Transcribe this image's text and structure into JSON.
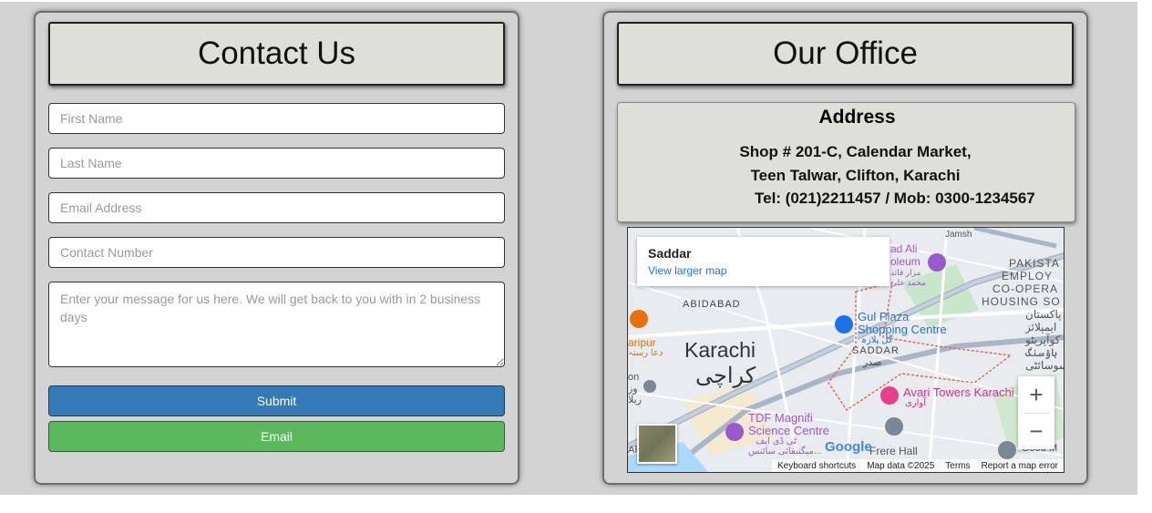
{
  "contact": {
    "title": "Contact Us",
    "first_name_placeholder": "First Name",
    "last_name_placeholder": "Last Name",
    "email_placeholder": "Email Address",
    "phone_placeholder": "Contact Number",
    "message_placeholder": "Enter your message for us here. We will get back to you with in 2 business days",
    "submit_label": "Submit",
    "email_label": "Email"
  },
  "office": {
    "title": "Our Office",
    "address_title": "Address",
    "address_line1": "Shop # 201-C, Calendar Market,",
    "address_line2": "Teen Talwar, Clifton, Karachi",
    "phone_line": "Tel: (021)2211457 / Mob: 0300-1234567"
  },
  "map": {
    "place_name": "Saddar",
    "view_larger": "View larger map",
    "zoom_in": "+",
    "zoom_out": "−",
    "city_en": "Karachi",
    "city_ur": "کراچی",
    "label_abidabad": "ABIDABAD",
    "label_saddar": "SADDAR",
    "label_saddar_ur": "صدر",
    "label_gulplaza": "Gul Plaza",
    "label_gulplaza2": "Shopping Centre",
    "label_gulplaza_ur": "گل پلازہ",
    "label_avari": "Avari Towers Karachi",
    "label_avari_ur": "آواری",
    "label_tdf": "TDF Magnifi",
    "label_tdf2": "Science Centre",
    "label_tdf_ur": "ٹی ڈی ایف",
    "label_tdf_ur2": "میگنیفائی سائنس...",
    "label_frere": "Frere Hall",
    "label_mausoleum": "ad Ali",
    "label_mausoleum2": "oleum",
    "label_mausoleum_ur": "مزار قائد",
    "label_mausoleum_ur2": "محمد علی",
    "label_haripur": "aripur",
    "label_haripur_ur": "دعا رستہ",
    "label_jamshed": "Jamsh",
    "label_pak1": "PAKISTA",
    "label_pak2": "EMPLOY",
    "label_pak3": "CO-OPERA",
    "label_pak4": "HOUSING SO",
    "label_pak_ur1": "پاکستان",
    "label_pak_ur2": "ایمپلائز",
    "label_pak_ur3": "کوآپریٹو",
    "label_pak_ur4": "ہاؤسنگ",
    "label_pak_ur5": "سوسائٹی",
    "label_left1": "on",
    "label_left2": "وز",
    "label_left3": "ریلا",
    "label_left4": "AF",
    "label_hood": "Good M",
    "google": "Google",
    "kbd": "Keyboard shortcuts",
    "mapdata": "Map data ©2025",
    "terms": "Terms",
    "report": "Report a map error",
    "colors": {
      "link": "#1a73e8",
      "poi_purple": "#9b59d0",
      "poi_pink": "#e83e8c",
      "poi_blue": "#1a73e8",
      "poi_orange": "#e8710a"
    }
  }
}
